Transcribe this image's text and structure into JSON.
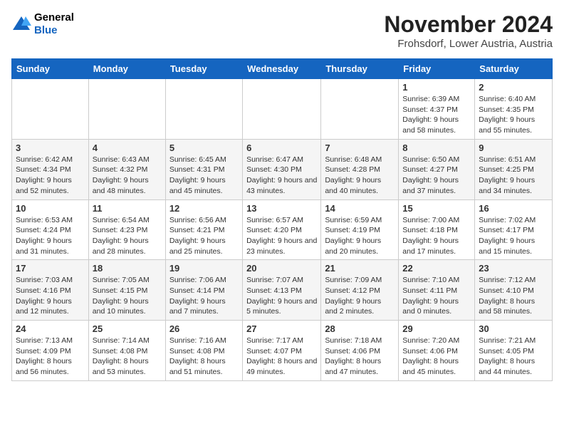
{
  "header": {
    "logo_line1": "General",
    "logo_line2": "Blue",
    "month": "November 2024",
    "location": "Frohsdorf, Lower Austria, Austria"
  },
  "weekdays": [
    "Sunday",
    "Monday",
    "Tuesday",
    "Wednesday",
    "Thursday",
    "Friday",
    "Saturday"
  ],
  "weeks": [
    [
      {
        "day": "",
        "info": ""
      },
      {
        "day": "",
        "info": ""
      },
      {
        "day": "",
        "info": ""
      },
      {
        "day": "",
        "info": ""
      },
      {
        "day": "",
        "info": ""
      },
      {
        "day": "1",
        "info": "Sunrise: 6:39 AM\nSunset: 4:37 PM\nDaylight: 9 hours and 58 minutes."
      },
      {
        "day": "2",
        "info": "Sunrise: 6:40 AM\nSunset: 4:35 PM\nDaylight: 9 hours and 55 minutes."
      }
    ],
    [
      {
        "day": "3",
        "info": "Sunrise: 6:42 AM\nSunset: 4:34 PM\nDaylight: 9 hours and 52 minutes."
      },
      {
        "day": "4",
        "info": "Sunrise: 6:43 AM\nSunset: 4:32 PM\nDaylight: 9 hours and 48 minutes."
      },
      {
        "day": "5",
        "info": "Sunrise: 6:45 AM\nSunset: 4:31 PM\nDaylight: 9 hours and 45 minutes."
      },
      {
        "day": "6",
        "info": "Sunrise: 6:47 AM\nSunset: 4:30 PM\nDaylight: 9 hours and 43 minutes."
      },
      {
        "day": "7",
        "info": "Sunrise: 6:48 AM\nSunset: 4:28 PM\nDaylight: 9 hours and 40 minutes."
      },
      {
        "day": "8",
        "info": "Sunrise: 6:50 AM\nSunset: 4:27 PM\nDaylight: 9 hours and 37 minutes."
      },
      {
        "day": "9",
        "info": "Sunrise: 6:51 AM\nSunset: 4:25 PM\nDaylight: 9 hours and 34 minutes."
      }
    ],
    [
      {
        "day": "10",
        "info": "Sunrise: 6:53 AM\nSunset: 4:24 PM\nDaylight: 9 hours and 31 minutes."
      },
      {
        "day": "11",
        "info": "Sunrise: 6:54 AM\nSunset: 4:23 PM\nDaylight: 9 hours and 28 minutes."
      },
      {
        "day": "12",
        "info": "Sunrise: 6:56 AM\nSunset: 4:21 PM\nDaylight: 9 hours and 25 minutes."
      },
      {
        "day": "13",
        "info": "Sunrise: 6:57 AM\nSunset: 4:20 PM\nDaylight: 9 hours and 23 minutes."
      },
      {
        "day": "14",
        "info": "Sunrise: 6:59 AM\nSunset: 4:19 PM\nDaylight: 9 hours and 20 minutes."
      },
      {
        "day": "15",
        "info": "Sunrise: 7:00 AM\nSunset: 4:18 PM\nDaylight: 9 hours and 17 minutes."
      },
      {
        "day": "16",
        "info": "Sunrise: 7:02 AM\nSunset: 4:17 PM\nDaylight: 9 hours and 15 minutes."
      }
    ],
    [
      {
        "day": "17",
        "info": "Sunrise: 7:03 AM\nSunset: 4:16 PM\nDaylight: 9 hours and 12 minutes."
      },
      {
        "day": "18",
        "info": "Sunrise: 7:05 AM\nSunset: 4:15 PM\nDaylight: 9 hours and 10 minutes."
      },
      {
        "day": "19",
        "info": "Sunrise: 7:06 AM\nSunset: 4:14 PM\nDaylight: 9 hours and 7 minutes."
      },
      {
        "day": "20",
        "info": "Sunrise: 7:07 AM\nSunset: 4:13 PM\nDaylight: 9 hours and 5 minutes."
      },
      {
        "day": "21",
        "info": "Sunrise: 7:09 AM\nSunset: 4:12 PM\nDaylight: 9 hours and 2 minutes."
      },
      {
        "day": "22",
        "info": "Sunrise: 7:10 AM\nSunset: 4:11 PM\nDaylight: 9 hours and 0 minutes."
      },
      {
        "day": "23",
        "info": "Sunrise: 7:12 AM\nSunset: 4:10 PM\nDaylight: 8 hours and 58 minutes."
      }
    ],
    [
      {
        "day": "24",
        "info": "Sunrise: 7:13 AM\nSunset: 4:09 PM\nDaylight: 8 hours and 56 minutes."
      },
      {
        "day": "25",
        "info": "Sunrise: 7:14 AM\nSunset: 4:08 PM\nDaylight: 8 hours and 53 minutes."
      },
      {
        "day": "26",
        "info": "Sunrise: 7:16 AM\nSunset: 4:08 PM\nDaylight: 8 hours and 51 minutes."
      },
      {
        "day": "27",
        "info": "Sunrise: 7:17 AM\nSunset: 4:07 PM\nDaylight: 8 hours and 49 minutes."
      },
      {
        "day": "28",
        "info": "Sunrise: 7:18 AM\nSunset: 4:06 PM\nDaylight: 8 hours and 47 minutes."
      },
      {
        "day": "29",
        "info": "Sunrise: 7:20 AM\nSunset: 4:06 PM\nDaylight: 8 hours and 45 minutes."
      },
      {
        "day": "30",
        "info": "Sunrise: 7:21 AM\nSunset: 4:05 PM\nDaylight: 8 hours and 44 minutes."
      }
    ]
  ]
}
